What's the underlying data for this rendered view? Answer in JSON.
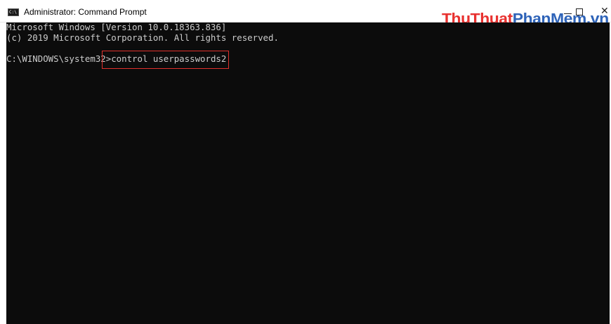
{
  "window": {
    "title": "Administrator: Command Prompt",
    "icon": "cmd-icon",
    "icon_label": "C:\\",
    "controls": {
      "minimize": "minimize-icon",
      "maximize": "maximize-icon",
      "close_symbol": "✕"
    }
  },
  "watermark": {
    "part1": "ThuThuat",
    "part2": "PhanMem.vn",
    "color1": "#e8312f",
    "color2": "#2e63b8"
  },
  "console": {
    "background": "#0c0c0c",
    "text_color": "#cccccc",
    "lines": [
      "Microsoft Windows [Version 10.0.18363.836]",
      "(c) 2019 Microsoft Corporation. All rights reserved."
    ],
    "prompt": "C:\\WINDOWS\\system32",
    "command": ">control userpasswords2",
    "highlight_color": "#e0302b"
  }
}
